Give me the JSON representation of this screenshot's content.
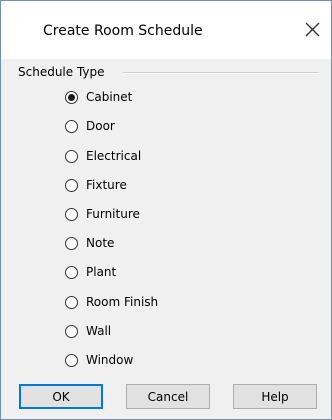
{
  "dialog": {
    "title": "Create Room Schedule",
    "close_glyph": "close-icon"
  },
  "group": {
    "label": "Schedule Type",
    "selected": "Cabinet",
    "options": [
      "Cabinet",
      "Door",
      "Electrical",
      "Fixture",
      "Furniture",
      "Note",
      "Plant",
      "Room Finish",
      "Wall",
      "Window"
    ]
  },
  "buttons": {
    "ok": "OK",
    "cancel": "Cancel",
    "help": "Help"
  },
  "colors": {
    "accent": "#0078d7",
    "dialog_bg": "#f0f0f0",
    "title_bg": "#ffffff"
  }
}
